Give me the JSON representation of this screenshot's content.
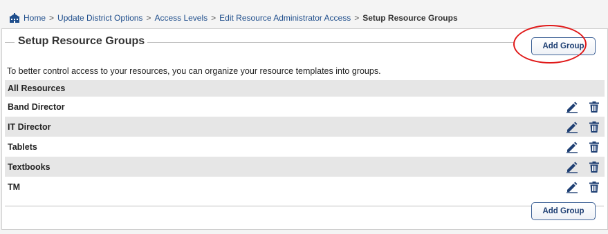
{
  "breadcrumb": {
    "items": [
      "Home",
      "Update District Options",
      "Access Levels",
      "Edit Resource Administrator Access"
    ],
    "separator": ">",
    "current": "Setup Resource Groups"
  },
  "panel": {
    "title": "Setup Resource Groups",
    "add_group_label": "Add Group",
    "description": "To better control access to your resources, you can organize your resource templates into groups."
  },
  "groups": {
    "header": "All Resources",
    "items": [
      "Band Director",
      "IT Director",
      "Tablets",
      "Textbooks",
      "TM"
    ]
  },
  "colors": {
    "link": "#1f4e8c",
    "icon": "#1e3f73",
    "highlight": "#e01818",
    "row_alt": "#e6e6e6"
  },
  "icons": [
    "home-icon",
    "edit-icon",
    "delete-icon"
  ]
}
